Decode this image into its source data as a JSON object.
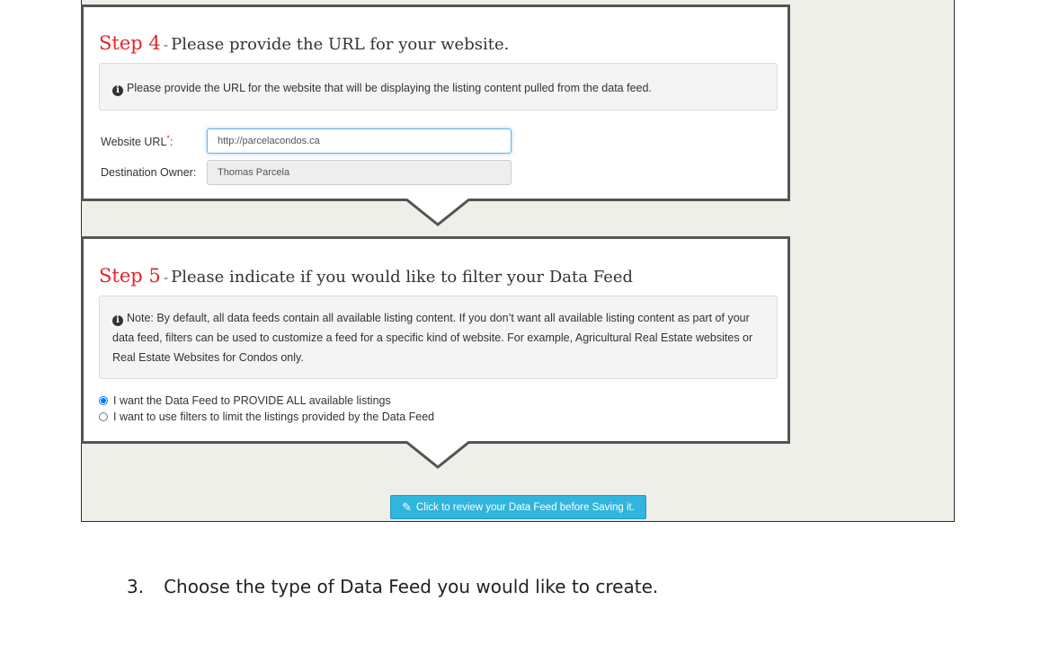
{
  "step4": {
    "number": "Step 4",
    "dash": "-",
    "title": "Please provide the URL for your website.",
    "info": "Please provide the URL for the website that will be displaying the listing content pulled from the data feed.",
    "url_label": "Website URL",
    "required_mark": "*",
    "url_suffix": ":",
    "url_value": "http://parcelacondos.ca",
    "owner_label": "Destination Owner:",
    "owner_value": "Thomas Parcela"
  },
  "step5": {
    "number": "Step 5",
    "dash": "-",
    "title": "Please indicate if you would like to filter your Data Feed",
    "info": "Note: By default, all data feeds contain all available listing content. If you don’t want all available listing content as part of your data feed, filters can be used to customize a feed for a specific kind of website. For example, Agricultural Real Estate websites or Real Estate Websites for Condos only.",
    "options": [
      {
        "label": "I want the Data Feed to PROVIDE ALL available listings",
        "selected": true
      },
      {
        "label": "I want to use filters to limit the listings provided by the Data Feed",
        "selected": false
      }
    ]
  },
  "review_button": "Click to review your Data Feed before Saving it.",
  "instruction": {
    "number": "3.",
    "text": "Choose the type of Data Feed you would like to create."
  },
  "colors": {
    "accent_red": "#e8232a",
    "button_blue": "#30b5dc",
    "panel_border": "#545454",
    "background": "#efefe9"
  },
  "icons": [
    "info-circle-icon",
    "pencil-icon",
    "pointer-arrow"
  ]
}
